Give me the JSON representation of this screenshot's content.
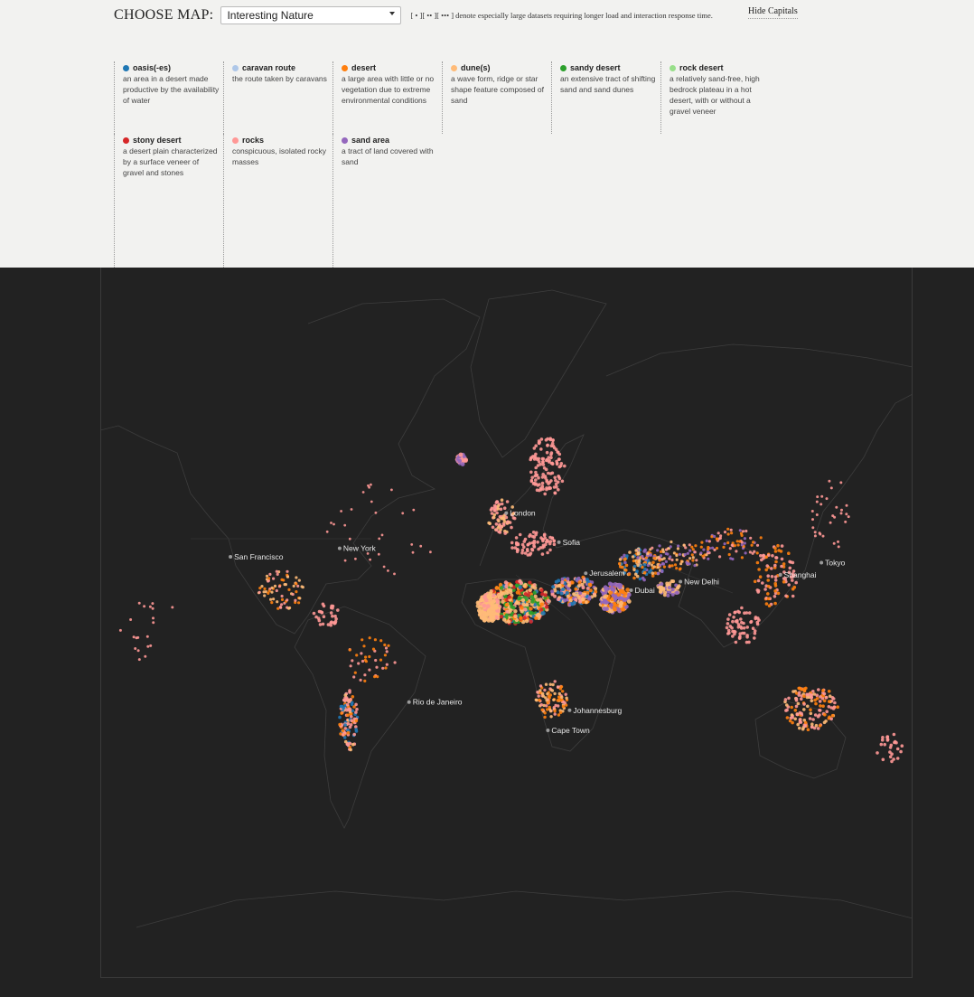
{
  "header": {
    "choose_label": "CHOOSE MAP:",
    "selected_map": "Interesting Nature",
    "note": "[ • ][ •• ][ ••• ] denote especially large datasets requiring longer load and interaction response time.",
    "hide_capitals": "Hide Capitals"
  },
  "legend": [
    {
      "name": "oasis(-es)",
      "desc": "an area in a desert made productive by the availability of water",
      "color": "#1f77b4"
    },
    {
      "name": "caravan route",
      "desc": "the route taken by caravans",
      "color": "#aec7e8"
    },
    {
      "name": "desert",
      "desc": "a large area with little or no vegetation due to extreme environmental conditions",
      "color": "#ff7f0e"
    },
    {
      "name": "dune(s)",
      "desc": "a wave form, ridge or star shape feature composed of sand",
      "color": "#ffbb78"
    },
    {
      "name": "sandy desert",
      "desc": "an extensive tract of shifting sand and sand dunes",
      "color": "#2ca02c"
    },
    {
      "name": "rock desert",
      "desc": "a relatively sand-free, high bedrock plateau in a hot desert, with or without a gravel veneer",
      "color": "#98df8a"
    },
    {
      "name": "stony desert",
      "desc": "a desert plain characterized by a surface veneer of gravel and stones",
      "color": "#d62728"
    },
    {
      "name": "rocks",
      "desc": "conspicuous, isolated rocky masses",
      "color": "#ff9896"
    },
    {
      "name": "sand area",
      "desc": "a tract of land covered with sand",
      "color": "#9467bd"
    }
  ],
  "cities": [
    {
      "name": "San Francisco",
      "lon": -122.4,
      "lat": 37.8
    },
    {
      "name": "New York",
      "lon": -74.0,
      "lat": 40.7
    },
    {
      "name": "London",
      "lon": -0.1,
      "lat": 51.5
    },
    {
      "name": "Sofia",
      "lon": 23.3,
      "lat": 42.7
    },
    {
      "name": "Jerusalem",
      "lon": 35.2,
      "lat": 31.8
    },
    {
      "name": "Dubai",
      "lon": 55.3,
      "lat": 25.2
    },
    {
      "name": "New Delhi",
      "lon": 77.2,
      "lat": 28.6
    },
    {
      "name": "Shanghai",
      "lon": 121.5,
      "lat": 31.2
    },
    {
      "name": "Tokyo",
      "lon": 139.7,
      "lat": 35.7
    },
    {
      "name": "Rio de Janeiro",
      "lon": -43.2,
      "lat": -22.9
    },
    {
      "name": "Johannesburg",
      "lon": 28.0,
      "lat": -26.2
    },
    {
      "name": "Cape Town",
      "lon": 18.4,
      "lat": -33.9
    }
  ],
  "colors": {
    "map_bg": "#222222",
    "coast": "#3d3d3d",
    "city_dot": "#9a9a9a"
  }
}
